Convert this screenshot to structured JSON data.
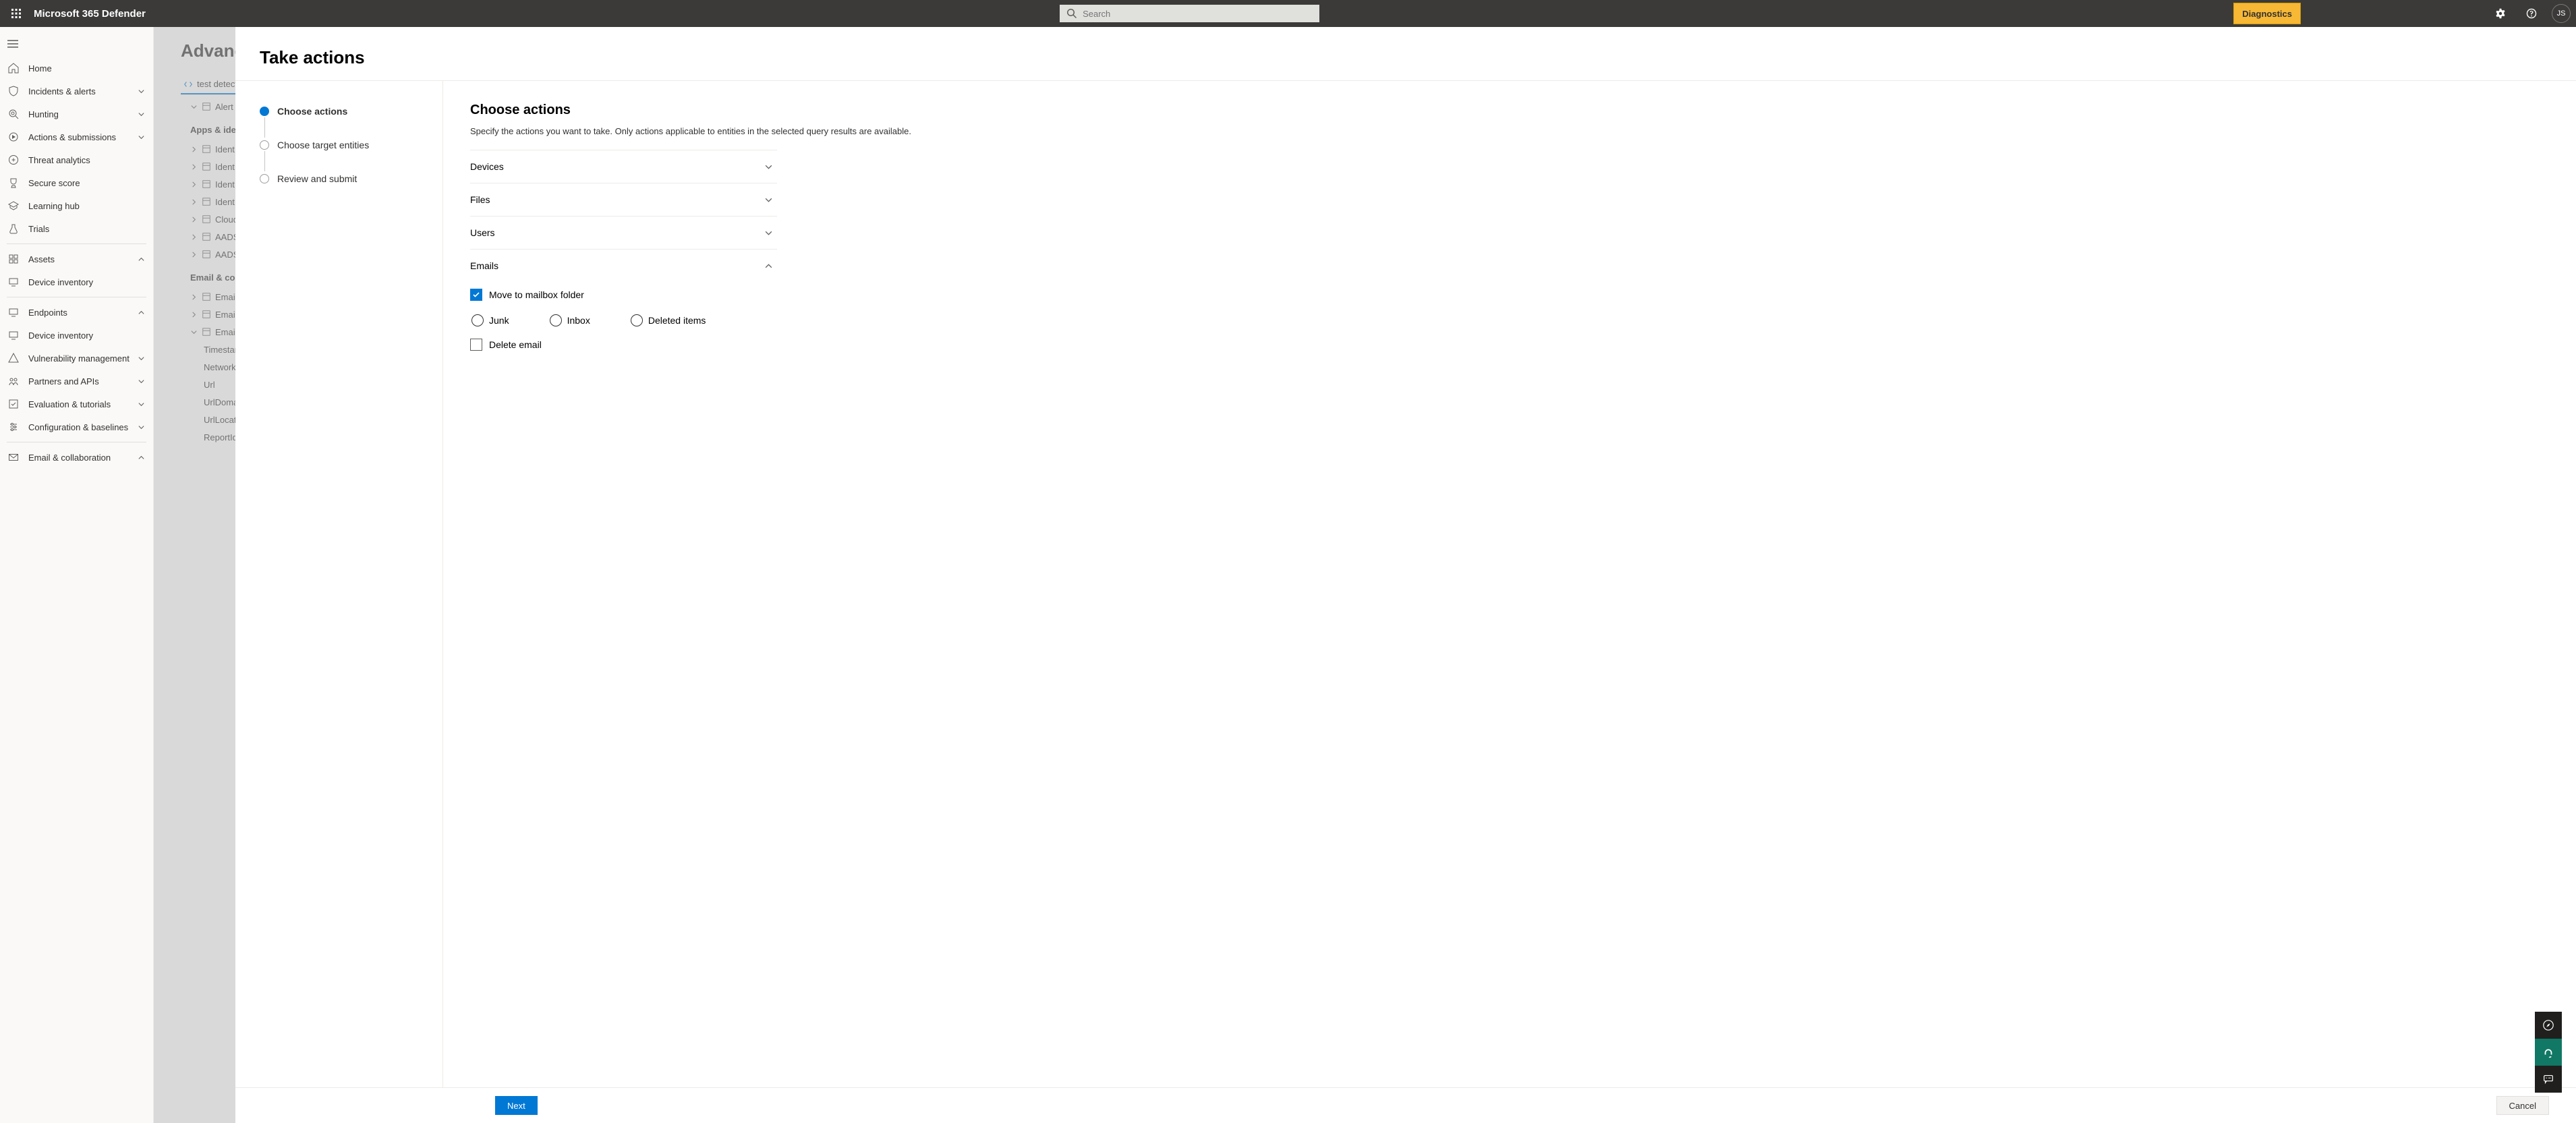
{
  "topbar": {
    "product_title": "Microsoft 365 Defender",
    "search_placeholder": "Search",
    "diagnostics_label": "Diagnostics",
    "avatar_initials": "JS"
  },
  "sidebar": {
    "home": "Home",
    "incidents": "Incidents & alerts",
    "hunting": "Hunting",
    "actions": "Actions & submissions",
    "threat_analytics": "Threat analytics",
    "secure_score": "Secure score",
    "learning_hub": "Learning hub",
    "trials": "Trials",
    "assets": "Assets",
    "device_inventory": "Device inventory",
    "endpoints": "Endpoints",
    "device_inventory2": "Device inventory",
    "vuln_mgmt": "Vulnerability management",
    "partners": "Partners and APIs",
    "eval": "Evaluation & tutorials",
    "config": "Configuration & baselines",
    "email_collab": "Email & collaboration"
  },
  "behind": {
    "page_title": "Advanc",
    "tab_name": "test detecti",
    "tree_row_alert": "Alert",
    "section1": "Apps & identities",
    "items1": [
      "Ident",
      "Ident",
      "Ident",
      "Ident",
      "Cloud",
      "AADS",
      "AADS"
    ],
    "section2": "Email & collab",
    "items2_closed": [
      "Email",
      "Email"
    ],
    "items2_open": "Email",
    "subitems2": [
      "Timestam",
      "Network",
      "Url",
      "UrlDoma",
      "UrlLocat",
      "ReportId"
    ]
  },
  "panel": {
    "title": "Take actions",
    "steps": [
      "Choose actions",
      "Choose target entities",
      "Review and submit"
    ],
    "section_title": "Choose actions",
    "section_desc": "Specify the actions you want to take. Only actions applicable to entities in the selected query results are available.",
    "accordion": {
      "devices": "Devices",
      "files": "Files",
      "users": "Users",
      "emails": "Emails"
    },
    "emails_body": {
      "move_label": "Move to mailbox folder",
      "radios": [
        "Junk",
        "Inbox",
        "Deleted items"
      ],
      "delete_label": "Delete email"
    },
    "footer": {
      "next": "Next",
      "cancel": "Cancel"
    }
  }
}
